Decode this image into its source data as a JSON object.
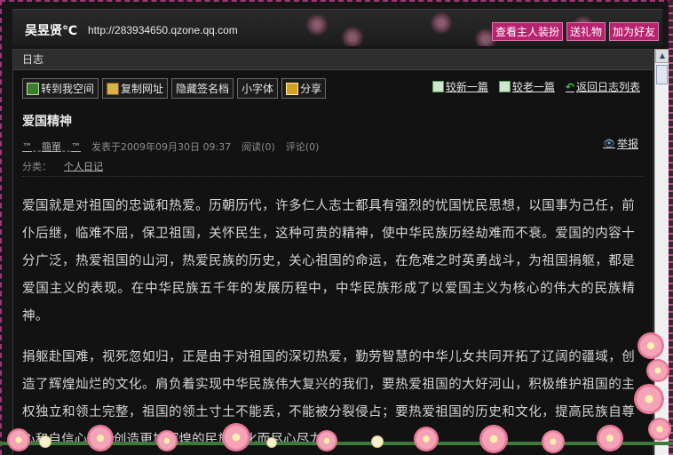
{
  "header": {
    "owner_name": "吴昱贤℃",
    "url": "http://283934650.qzone.qq.com",
    "buttons": [
      "查看主人装扮",
      "送礼物",
      "加为好友"
    ]
  },
  "panel": {
    "title": "日志"
  },
  "toolbar": {
    "buttons": [
      {
        "label": "转到我空间",
        "icon": "home-icon"
      },
      {
        "label": "复制网址",
        "icon": "copy-icon"
      },
      {
        "label": "隐藏签名档",
        "icon": ""
      },
      {
        "label": "小字体",
        "icon": ""
      },
      {
        "label": "分享",
        "icon": "share-icon"
      }
    ]
  },
  "nav": {
    "newer": "较新一篇",
    "older": "较老一篇",
    "back": "返回日志列表"
  },
  "post": {
    "title": "爱国精神",
    "author": "™ˍˍ簡單ˍˍ™",
    "published": "发表于2009年09月30日  09:37",
    "reads": "阅读(0)",
    "comments": "评论(0)",
    "report": "举报",
    "category_label": "分类：",
    "category": "个人日记",
    "paragraphs": [
      "爱国就是对祖国的忠诚和热爱。历朝历代，许多仁人志士都具有强烈的忧国忧民思想，以国事为己任，前仆后继，临难不屈，保卫祖国，关怀民生，这种可贵的精神，使中华民族历经劫难而不衰。爱国的内容十分广泛，热爱祖国的山河，热爱民族的历史，关心祖国的命运，在危难之时英勇战斗，为祖国捐躯，都是爱国主义的表现。在中华民族五千年的发展历程中，中华民族形成了以爱国主义为核心的伟大的民族精神。",
      "捐躯赴国难，视死忽如归，正是由于对祖国的深切热爱，勤劳智慧的中华儿女共同开拓了辽阔的疆域，创造了辉煌灿烂的文化。肩负着实现中华民族伟大复兴的我们，要热爱祖国的大好河山，积极维护祖国的主权独立和领土完整，祖国的领土寸土不能丢，不能被分裂侵占；要热爱祖国的历史和文化，提高民族自尊心和自信心，为创造更加辉煌的民族文化而尽心尽力。"
    ]
  },
  "colors": {
    "accent": "#b8226e",
    "frame": "#a2357a",
    "background": "#161616"
  }
}
